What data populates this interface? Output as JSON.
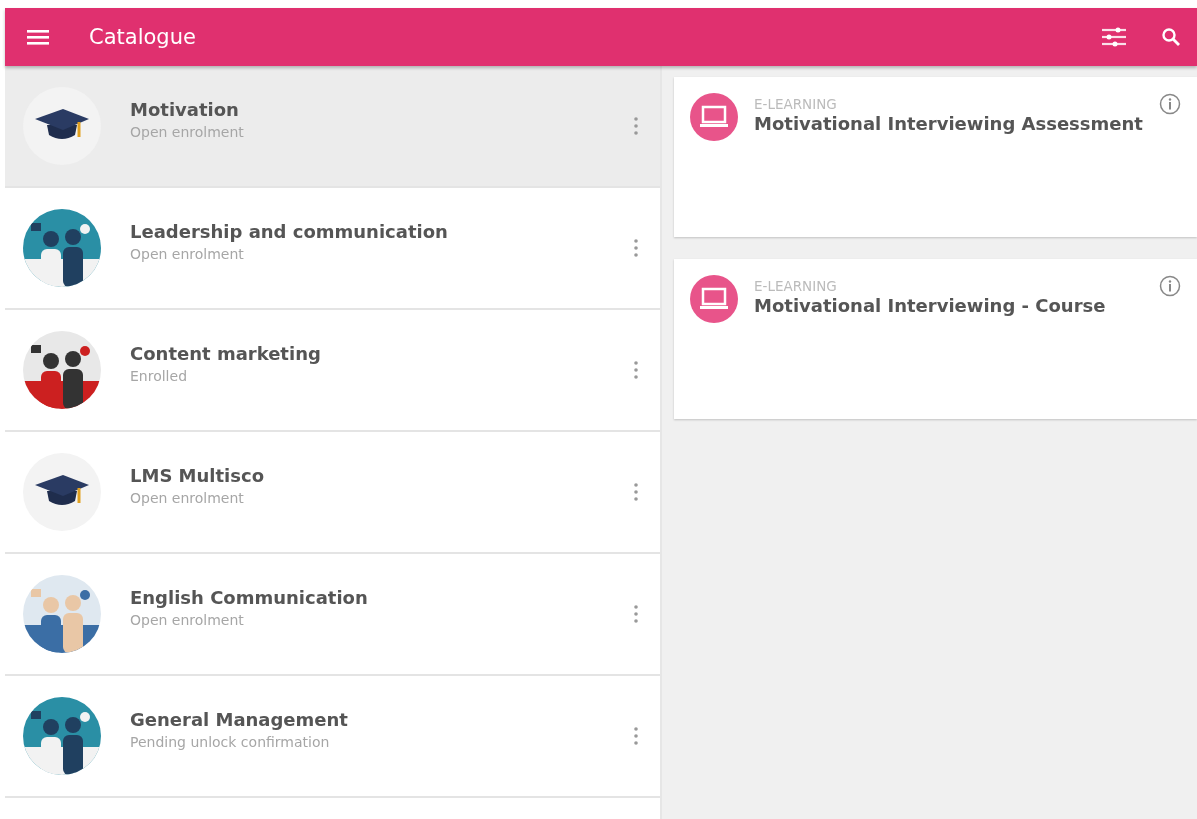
{
  "app_bar": {
    "title": "Catalogue"
  },
  "courses": [
    {
      "kind": "cap",
      "title": "Motivation",
      "status": "Open enrolment",
      "selected": true
    },
    {
      "kind": "picture",
      "title": "Leadership and communication",
      "status": "Open enrolment",
      "selected": false
    },
    {
      "kind": "picture",
      "title": "Content marketing",
      "status": "Enrolled",
      "selected": false
    },
    {
      "kind": "cap",
      "title": "LMS Multisco",
      "status": "Open enrolment",
      "selected": false
    },
    {
      "kind": "picture",
      "title": "English Communication",
      "status": "Open enrolment",
      "selected": false
    },
    {
      "kind": "picture",
      "title": "General Management",
      "status": "Pending unlock confirmation",
      "selected": false
    }
  ],
  "activities": [
    {
      "type": "E-LEARNING",
      "title": "Motivational Interviewing Assessment"
    },
    {
      "type": "E-LEARNING",
      "title": "Motivational Interviewing - Course"
    }
  ]
}
